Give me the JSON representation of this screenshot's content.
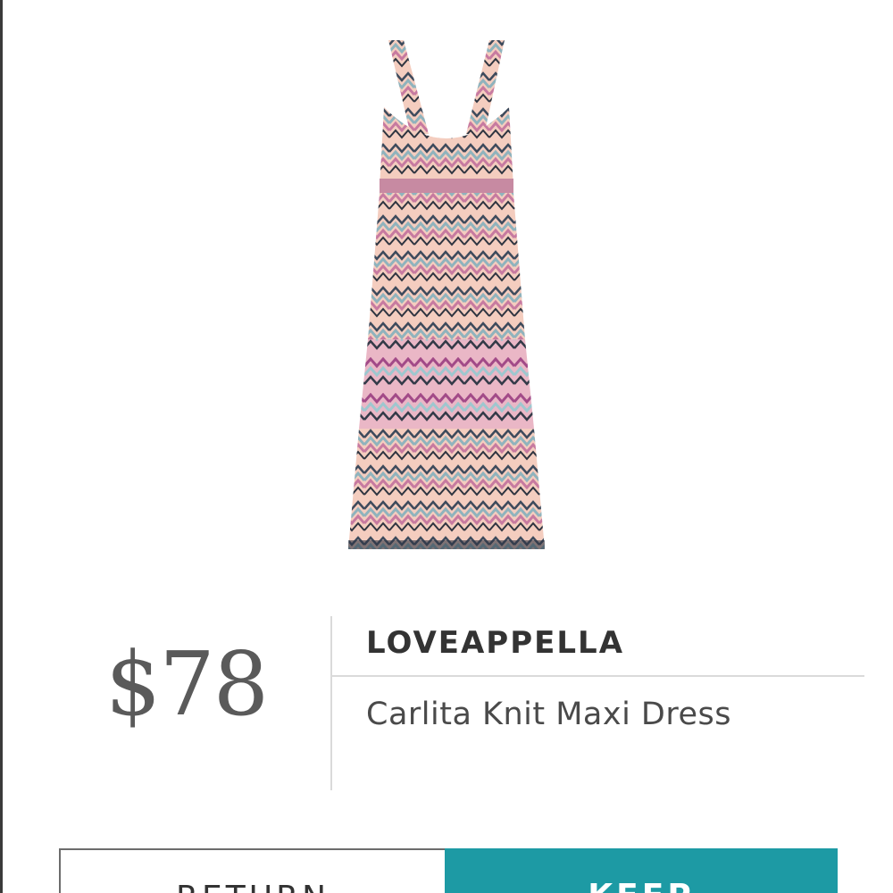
{
  "item": {
    "brand": "LOVEAPPELLA",
    "name": "Carlita Knit Maxi Dress",
    "price": "$78"
  },
  "actions": {
    "return_label": "RETURN",
    "keep_label": "KEEP"
  },
  "colors": {
    "keep_button": "#1d9aa4",
    "price_text": "#5a5a5a",
    "divider": "#dadada"
  }
}
